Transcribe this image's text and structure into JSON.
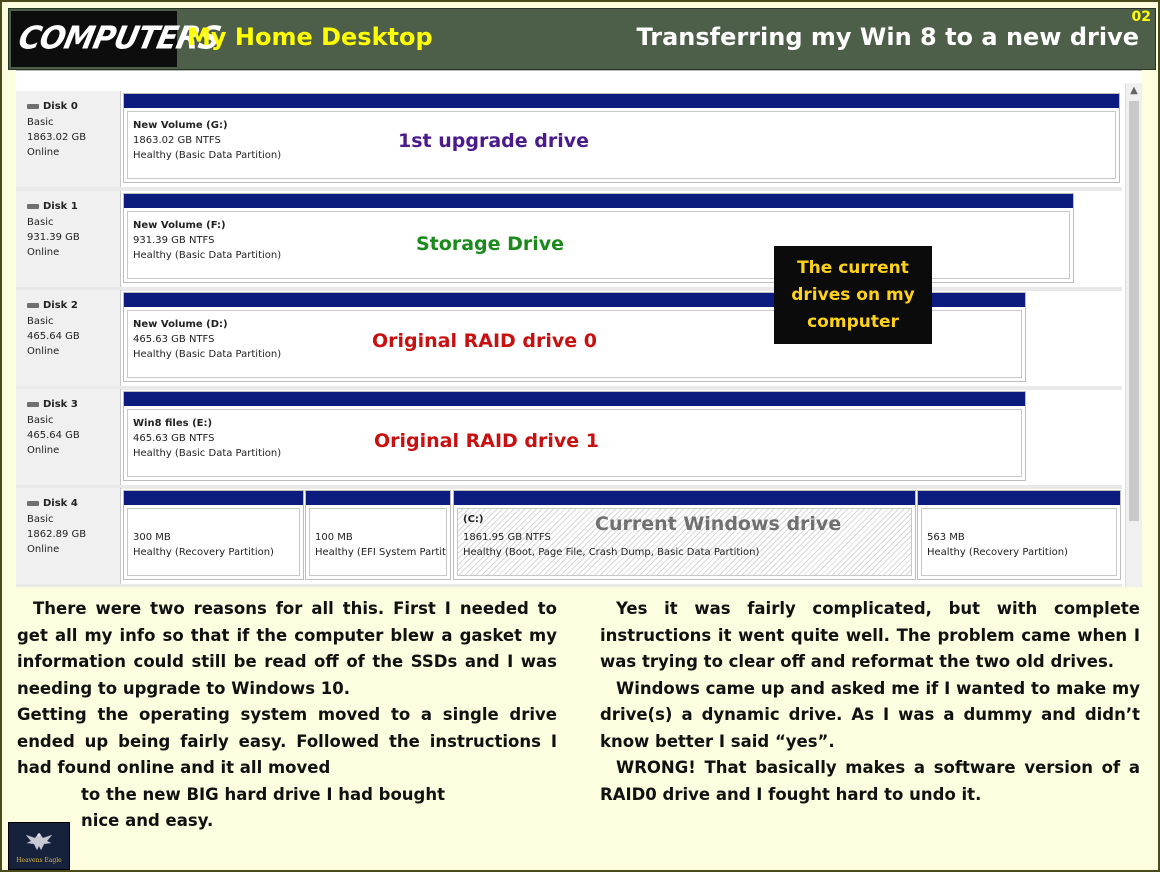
{
  "header": {
    "logo_text": "COMPUTERS",
    "title": "My Home Desktop",
    "subtitle": "Transferring my Win 8 to a new drive",
    "page_number": "02"
  },
  "disks": [
    {
      "name": "Disk 0",
      "type": "Basic",
      "size": "1863.02 GB",
      "status": "Online",
      "partitions": [
        {
          "name": "New Volume  (G:)",
          "size": "1863.02 GB NTFS",
          "status": "Healthy (Basic Data Partition)"
        }
      ],
      "annotation": "1st upgrade drive"
    },
    {
      "name": "Disk 1",
      "type": "Basic",
      "size": "931.39 GB",
      "status": "Online",
      "partitions": [
        {
          "name": "New Volume  (F:)",
          "size": "931.39 GB NTFS",
          "status": "Healthy (Basic Data Partition)"
        }
      ],
      "annotation": "Storage Drive"
    },
    {
      "name": "Disk 2",
      "type": "Basic",
      "size": "465.64 GB",
      "status": "Online",
      "partitions": [
        {
          "name": "New Volume  (D:)",
          "size": "465.63 GB NTFS",
          "status": "Healthy (Basic Data Partition)"
        }
      ],
      "annotation": "Original RAID drive 0"
    },
    {
      "name": "Disk 3",
      "type": "Basic",
      "size": "465.64 GB",
      "status": "Online",
      "partitions": [
        {
          "name": "Win8 files  (E:)",
          "size": "465.63 GB NTFS",
          "status": "Healthy (Basic Data Partition)"
        }
      ],
      "annotation": "Original RAID drive 1"
    },
    {
      "name": "Disk 4",
      "type": "Basic",
      "size": "1862.89 GB",
      "status": "Online",
      "partitions": [
        {
          "name": "",
          "size": "300 MB",
          "status": "Healthy (Recovery Partition)"
        },
        {
          "name": "",
          "size": "100 MB",
          "status": "Healthy (EFI System Partiti"
        },
        {
          "name": "(C:)",
          "size": "1861.95 GB NTFS",
          "status": "Healthy (Boot, Page File, Crash Dump, Basic Data Partition)"
        },
        {
          "name": "",
          "size": "563 MB",
          "status": "Healthy (Recovery Partition)"
        }
      ],
      "annotation": "Current Windows drive"
    }
  ],
  "callout": {
    "line1": "The current",
    "line2": "drives on my",
    "line3": "computer"
  },
  "left_column": {
    "p1": "There were two reasons for all this.  First I needed to get all my info so that if the computer blew a gasket my information could still be read off of the SSDs and I was needing to upgrade to Windows 10.",
    "p2": "Getting the operating system moved to a single drive ended up being fairly easy. Followed the instructions I had found online and it all moved",
    "p3": "to the new BIG hard drive I had bought",
    "p4": "nice and easy."
  },
  "right_column": {
    "p1": "Yes it was fairly complicated, but with complete instructions it went quite well.  The problem came when I was trying to clear off and reformat the two old drives.",
    "p2": "Windows came up and asked me if I wanted to make my drive(s) a dynamic drive. As I was a dummy and didn’t know better I said “yes”.",
    "p3": "WRONG! That basically makes a software version of a RAID0 drive and I fought hard to undo it."
  },
  "footer_logo": {
    "text": "Heavens Eagle",
    "icon": "eagle-icon"
  },
  "colors": {
    "header_bg": "#4d5e49",
    "title_yellow": "#ffff00",
    "partition_bar": "#0b1b7e",
    "annot_purple": "#4b1a8c",
    "annot_green": "#1a8a1a",
    "annot_red": "#c81010",
    "annot_gray": "#707070",
    "callout_text": "#ffd21a"
  }
}
